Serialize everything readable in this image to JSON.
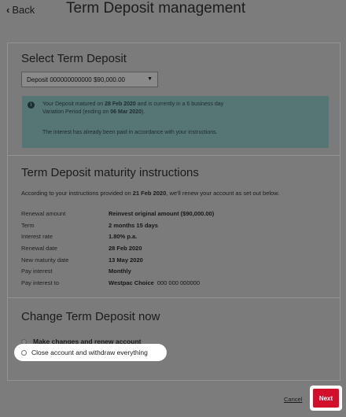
{
  "header": {
    "back_label": "Back",
    "title": "Term Deposit management"
  },
  "select_section": {
    "heading": "Select Term Deposit",
    "dropdown_value": "Deposit  000000000000 $90,000.00",
    "notice": {
      "line1_prefix": "Your Deposit matured on ",
      "matured_date": "28 Feb 2020",
      "line1_suffix": " and is currently in a 6 business day",
      "line2_prefix": "Variation Period (ending on ",
      "variation_end": "06 Mar 2020",
      "line2_suffix": ").",
      "line3": "The interest has already been paid in accordance with your instructions."
    }
  },
  "instructions_section": {
    "heading": "Term Deposit  maturity instructions",
    "intro_prefix": "According to your instructions provided on ",
    "intro_date": "21 Feb 2020",
    "intro_suffix": ", we'll renew your account as set out below.",
    "rows": [
      {
        "label": "Renewal amount",
        "value": "Reinvest original amount ($90,000.00)"
      },
      {
        "label": "Term",
        "value": "2 months 15 days"
      },
      {
        "label": "Interest rate",
        "value": "1.80% p.a."
      },
      {
        "label": "Renewal date",
        "value": "28 Feb 2020"
      },
      {
        "label": "New maturity date",
        "value": "13 May 2020"
      },
      {
        "label": "Pay interest",
        "value": "Monthly"
      },
      {
        "label": "Pay interest to",
        "value": "Westpac Choice",
        "extra": "000  000 000000"
      }
    ]
  },
  "change_section": {
    "heading": "Change Term Deposit now",
    "option_renew": "Make changes and renew account",
    "option_close": "Close account and withdraw everything"
  },
  "footer": {
    "cancel_label": "Cancel",
    "next_label": "Next"
  },
  "colors": {
    "next_button": "#d2102c",
    "notice_bg": "#567676"
  }
}
